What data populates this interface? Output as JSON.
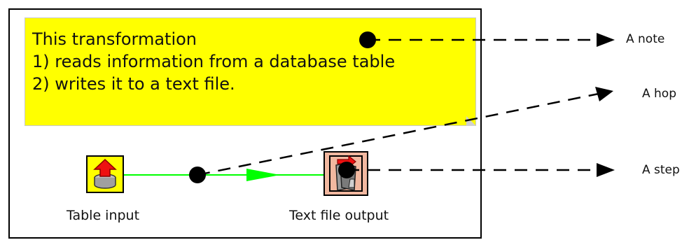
{
  "note": {
    "lines": [
      "This transformation",
      "1) reads information from a database table",
      "2) writes it to a text file."
    ]
  },
  "steps": [
    {
      "label": "Table input",
      "icon": "table-input-icon"
    },
    {
      "label": "Text file output",
      "icon": "text-file-output-icon"
    }
  ],
  "hop": {
    "color": "#00ff00"
  },
  "callouts": {
    "note_label": "A note",
    "hop_label": "A hop",
    "step_label": "A step"
  },
  "colors": {
    "note_background": "#ffff00",
    "table_input_background": "#ffff00",
    "text_file_output_background": "#f2b8a0"
  }
}
